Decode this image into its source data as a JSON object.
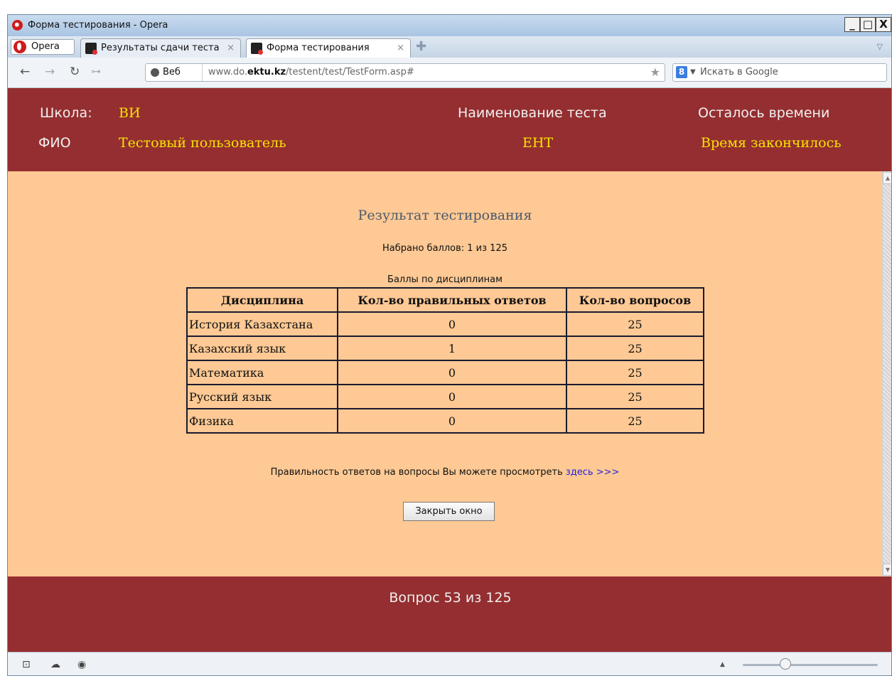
{
  "window": {
    "title": "Форма тестирования - Opera",
    "controls": [
      "_",
      "□",
      "X"
    ]
  },
  "tabs": {
    "menu_label": "Opera",
    "items": [
      {
        "label": "Результаты сдачи теста",
        "close": "×"
      },
      {
        "label": "Форма тестирования",
        "close": "×"
      }
    ],
    "new_tab": "✚"
  },
  "navbar": {
    "site_label": "Веб",
    "url_prefix": "www.do.",
    "url_domain": "ektu.kz",
    "url_path": "/testent/test/TestForm.asp#",
    "search_engine": "8",
    "search_placeholder": "Искать в Google"
  },
  "header": {
    "school_label": "Школа:",
    "school_value": "ВИ",
    "fio_label": "ФИО",
    "fio_value": "Тестовый пользователь",
    "test_name_label": "Наименование теста",
    "test_name_value": "ЕНТ",
    "time_label": "Осталось времени",
    "time_value": "Время закончилось"
  },
  "result": {
    "title": "Результат тестирования",
    "score": "Набрано баллов: 1 из 125",
    "table_caption": "Баллы по дисциплинам",
    "columns": [
      "Дисциплина",
      "Кол-во правильных ответов",
      "Кол-во вопросов"
    ],
    "rows": [
      [
        "История Казахстана",
        "0",
        "25"
      ],
      [
        "Казахский язык",
        "1",
        "25"
      ],
      [
        "Математика",
        "0",
        "25"
      ],
      [
        "Русский язык",
        "0",
        "25"
      ],
      [
        "Физика",
        "0",
        "25"
      ]
    ],
    "review_text": "Правильность ответов на вопросы Вы можете просмотреть ",
    "review_link": "здесь >>>",
    "close_button": "Закрыть окно"
  },
  "footer": {
    "question": "Вопрос 53 из 125"
  },
  "colors": {
    "header_bg": "#952e30",
    "content_bg": "#fec994",
    "highlight_text": "#f6e400",
    "link": "#2222dd"
  }
}
